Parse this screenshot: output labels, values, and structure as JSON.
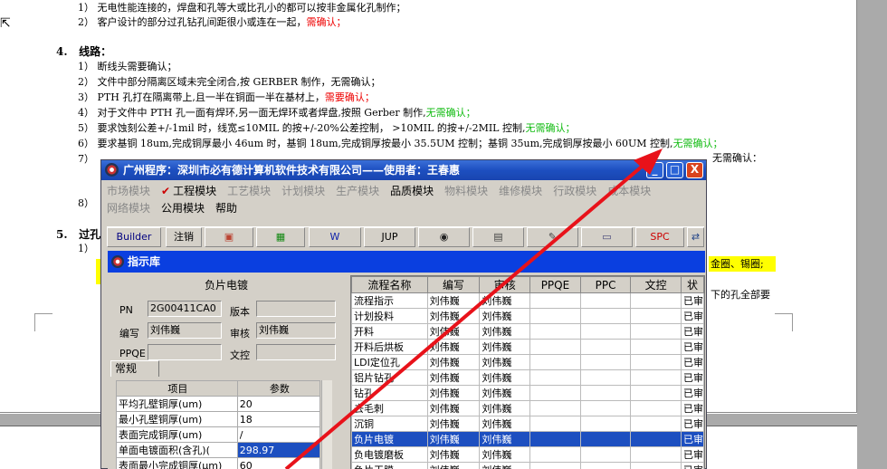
{
  "document": {
    "lines_top": [
      {
        "prefix": "1）",
        "text": "无电性能连接的，焊盘和孔等大或比孔小的都可以按非金属化孔制作；",
        "red": "",
        "green": ""
      },
      {
        "prefix": "2）",
        "text": "客户设计的部分过孔钻孔间距很小或连在一起，",
        "red": "需确认；",
        "green": ""
      }
    ],
    "section4": {
      "num": "4.",
      "title": "线路："
    },
    "lines_s4": [
      {
        "prefix": "1）",
        "text": "断线头需要确认；",
        "red": "",
        "green": ""
      },
      {
        "prefix": "2）",
        "text": "文件中部分隔离区域未完全闭合,按 GERBER 制作，无需确认；",
        "red": "",
        "green": ""
      },
      {
        "prefix": "3）",
        "text": "PTH 孔打在隔离带上,且一半在铜面一半在基材上，",
        "red": "需要确认；",
        "green": ""
      },
      {
        "prefix": "4）",
        "text": "对于文件中 PTH 孔一面有焊环,另一面无焊环或者焊盘,按照 Gerber 制作,",
        "red": "",
        "green": "无需确认；"
      },
      {
        "prefix": "5）",
        "text": "要求蚀刻公差+/-1mil 时，线宽≤10MIL 的按+/-20%公差控制， >10MIL 的按+/-2MIL 控制,",
        "red": "",
        "green": "无需确认；"
      },
      {
        "prefix": "6）",
        "text": "要求基铜 18um,完成铜厚最小 46um 时，基铜 18um,完成铜厚按最小 35.5UM 控制；基铜 35um,完成铜厚按最小 60UM 控制,",
        "red": "",
        "green": "无需确认；"
      },
      {
        "prefix": "7）",
        "text": "",
        "red": "",
        "green": ""
      }
    ],
    "line7_tail": "无需确认：",
    "line8_prefix": "8）",
    "section5": {
      "num": "5.",
      "title": "过孔"
    },
    "line5_1_prefix": "1）",
    "right_fragment_1": "金圈、锡圈;",
    "right_fragment_2": "下的孔全部要"
  },
  "app": {
    "title": "广州程序：深圳市必有德计算机软件技术有限公司——使用者：王春惠",
    "window_buttons": {
      "minimize": "_",
      "maximize": "□",
      "close": "X"
    },
    "menu_row1": [
      {
        "label": "市场模块",
        "enabled": false,
        "checked": false
      },
      {
        "label": "工程模块",
        "enabled": true,
        "checked": true
      },
      {
        "label": "工艺模块",
        "enabled": false,
        "checked": false
      },
      {
        "label": "计划模块",
        "enabled": false,
        "checked": false
      },
      {
        "label": "生产模块",
        "enabled": false,
        "checked": false
      },
      {
        "label": "品质模块",
        "enabled": true,
        "checked": false
      },
      {
        "label": "物料模块",
        "enabled": false,
        "checked": false
      },
      {
        "label": "维修模块",
        "enabled": false,
        "checked": false
      },
      {
        "label": "行政模块",
        "enabled": false,
        "checked": false
      },
      {
        "label": "成本模块",
        "enabled": false,
        "checked": false
      }
    ],
    "menu_row2": [
      {
        "label": "网络模块",
        "enabled": false
      },
      {
        "label": "公用模块",
        "enabled": true
      },
      {
        "label": "帮助",
        "enabled": true
      }
    ],
    "check_mark": "✔",
    "toolbar": [
      {
        "label": "Builder",
        "icon": "builder-text",
        "color": "#000080"
      },
      {
        "label": "注销",
        "icon": "logout-text",
        "color": "#000"
      },
      {
        "label": "▣",
        "icon": "image-icon",
        "color": "#b43"
      },
      {
        "label": "▦",
        "icon": "excel-icon",
        "color": "#181"
      },
      {
        "label": "W",
        "icon": "word-icon",
        "color": "#12a"
      },
      {
        "label": "JUP",
        "icon": "jup-text",
        "color": "#000"
      },
      {
        "label": "◉",
        "icon": "eye-icon",
        "color": "#222"
      },
      {
        "label": "▤",
        "icon": "database-icon",
        "color": "#444"
      },
      {
        "label": "✎",
        "icon": "tools-icon",
        "color": "#444"
      },
      {
        "label": "▭",
        "icon": "monitor-icon",
        "color": "#447"
      },
      {
        "label": "SPC",
        "icon": "spc-text",
        "color": "#c00"
      },
      {
        "label": "⇄",
        "icon": "sync-icon",
        "color": "#248"
      }
    ]
  },
  "inner": {
    "title": "指示库",
    "panel_title": "负片电镀",
    "fields": {
      "pn_label": "PN",
      "pn_value": "2G00411CA0",
      "version_label": "版本",
      "version_value": "",
      "author_label": "编写",
      "author_value": "刘伟巍",
      "review_label": "审核",
      "review_value": "刘伟巍",
      "ppqe_label": "PPQE",
      "ppqe_value": "",
      "doc_label": "文控",
      "doc_value": ""
    },
    "tab_normal": "常规",
    "params_headers": [
      "项目",
      "参数"
    ],
    "params": [
      {
        "item": "平均孔壁铜厚(um)",
        "value": "20",
        "selected": false
      },
      {
        "item": "最小孔壁铜厚(um)",
        "value": "18",
        "selected": false
      },
      {
        "item": "表面完成铜厚(um)",
        "value": "/",
        "selected": false
      },
      {
        "item": "单面电镀面积(含孔)(",
        "value": "298.97",
        "selected": true
      },
      {
        "item": "表面最小完成铜厚(μm)",
        "value": "60",
        "selected": false
      }
    ],
    "flow_headers": [
      "流程名称",
      "编写",
      "审核",
      "PPQE",
      "PPC",
      "文控",
      "状"
    ],
    "flow_rows": [
      {
        "name": "流程指示",
        "author": "刘伟巍",
        "review": "刘伟巍",
        "status": "已审",
        "selected": false
      },
      {
        "name": "计划投料",
        "author": "刘伟巍",
        "review": "刘伟巍",
        "status": "已审",
        "selected": false
      },
      {
        "name": "开料",
        "author": "刘伟巍",
        "review": "刘伟巍",
        "status": "已审",
        "selected": false
      },
      {
        "name": "开料后烘板",
        "author": "刘伟巍",
        "review": "刘伟巍",
        "status": "已审",
        "selected": false
      },
      {
        "name": "LDI定位孔",
        "author": "刘伟巍",
        "review": "刘伟巍",
        "status": "已审",
        "selected": false
      },
      {
        "name": "铝片钻孔",
        "author": "刘伟巍",
        "review": "刘伟巍",
        "status": "已审",
        "selected": false
      },
      {
        "name": "钻孔",
        "author": "刘伟巍",
        "review": "刘伟巍",
        "status": "已审",
        "selected": false
      },
      {
        "name": "去毛刺",
        "author": "刘伟巍",
        "review": "刘伟巍",
        "status": "已审",
        "selected": false
      },
      {
        "name": "沉铜",
        "author": "刘伟巍",
        "review": "刘伟巍",
        "status": "已审",
        "selected": false
      },
      {
        "name": "负片电镀",
        "author": "刘伟巍",
        "review": "刘伟巍",
        "status": "已审",
        "selected": true
      },
      {
        "name": "负电镀磨板",
        "author": "刘伟巍",
        "review": "刘伟巍",
        "status": "已审",
        "selected": false
      },
      {
        "name": "负片干膜",
        "author": "刘伟巍",
        "review": "刘伟巍",
        "status": "已审",
        "selected": false
      }
    ]
  },
  "colors": {
    "annotation_arrow": "#e8121a",
    "selection": "#1d4fc0",
    "titlebar": "#1d4fc0"
  }
}
